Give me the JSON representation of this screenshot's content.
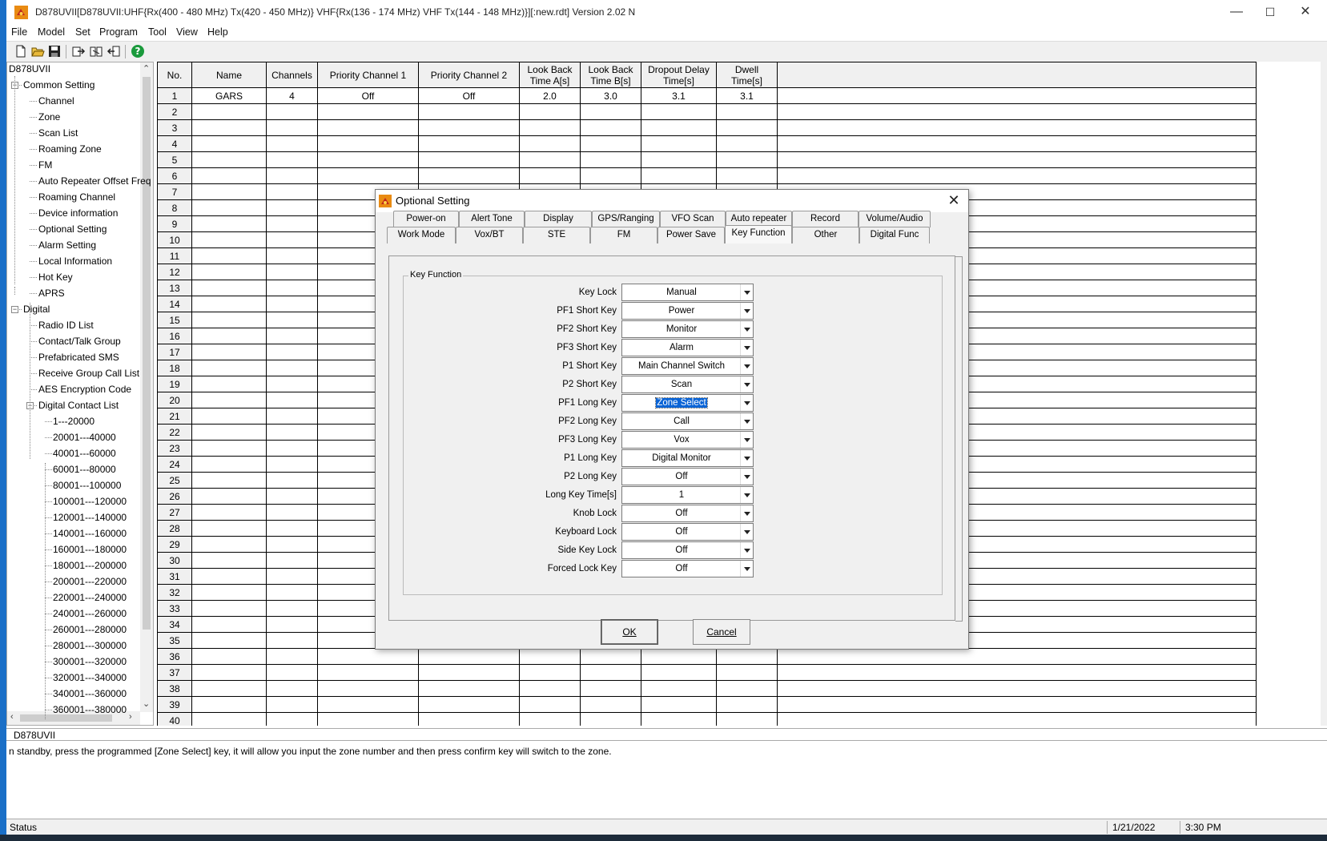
{
  "window": {
    "title": "D878UVII[D878UVII:UHF{Rx(400 - 480 MHz) Tx(420 - 450 MHz)} VHF{Rx(136 - 174 MHz) VHF Tx(144 - 148 MHz)}][:new.rdt] Version 2.02 N",
    "minimize": "—",
    "maximize": "☐",
    "close": "✕"
  },
  "menu": [
    "File",
    "Model",
    "Set",
    "Program",
    "Tool",
    "View",
    "Help"
  ],
  "toolbar": {
    "icons": [
      "new-file-icon",
      "open-folder-icon",
      "save-icon",
      "read-from-radio-icon",
      "write-to-radio-icon",
      "transfer-icon",
      "help-icon"
    ]
  },
  "tree": {
    "root": "D878UVII",
    "nodes": [
      {
        "label": "Common Setting",
        "level": 1,
        "expander": "−"
      },
      {
        "label": "Channel",
        "level": 2
      },
      {
        "label": "Zone",
        "level": 2
      },
      {
        "label": "Scan List",
        "level": 2
      },
      {
        "label": "Roaming Zone",
        "level": 2
      },
      {
        "label": "FM",
        "level": 2
      },
      {
        "label": "Auto Repeater Offset Freq",
        "level": 2
      },
      {
        "label": "Roaming Channel",
        "level": 2
      },
      {
        "label": "Device information",
        "level": 2
      },
      {
        "label": "Optional Setting",
        "level": 2
      },
      {
        "label": "Alarm Setting",
        "level": 2
      },
      {
        "label": "Local Information",
        "level": 2
      },
      {
        "label": "Hot Key",
        "level": 2
      },
      {
        "label": "APRS",
        "level": 2
      },
      {
        "label": "Digital",
        "level": 1,
        "expander": "−"
      },
      {
        "label": "Radio ID List",
        "level": 2
      },
      {
        "label": "Contact/Talk Group",
        "level": 2
      },
      {
        "label": "Prefabricated SMS",
        "level": 2
      },
      {
        "label": "Receive Group Call List",
        "level": 2
      },
      {
        "label": "AES Encryption Code",
        "level": 2
      },
      {
        "label": "Digital Contact List",
        "level": 2,
        "expander": "−"
      },
      {
        "label": "1---20000",
        "level": 3
      },
      {
        "label": "20001---40000",
        "level": 3
      },
      {
        "label": "40001---60000",
        "level": 3
      },
      {
        "label": "60001---80000",
        "level": 3
      },
      {
        "label": "80001---100000",
        "level": 3
      },
      {
        "label": "100001---120000",
        "level": 3
      },
      {
        "label": "120001---140000",
        "level": 3
      },
      {
        "label": "140001---160000",
        "level": 3
      },
      {
        "label": "160001---180000",
        "level": 3
      },
      {
        "label": "180001---200000",
        "level": 3
      },
      {
        "label": "200001---220000",
        "level": 3
      },
      {
        "label": "220001---240000",
        "level": 3
      },
      {
        "label": "240001---260000",
        "level": 3
      },
      {
        "label": "260001---280000",
        "level": 3
      },
      {
        "label": "280001---300000",
        "level": 3
      },
      {
        "label": "300001---320000",
        "level": 3
      },
      {
        "label": "320001---340000",
        "level": 3
      },
      {
        "label": "340001---360000",
        "level": 3
      },
      {
        "label": "360001---380000",
        "level": 3
      }
    ]
  },
  "grid": {
    "columns": [
      "No.",
      "Name",
      "Channels",
      "Priority Channel 1",
      "Priority Channel 2",
      "Look Back Time A[s]",
      "Look Back Time B[s]",
      "Dropout Delay Time[s]",
      "Dwell Time[s]",
      ""
    ],
    "row_count": 40,
    "rows": [
      [
        "1",
        "GARS",
        "4",
        "Off",
        "Off",
        "2.0",
        "3.0",
        "3.1",
        "3.1",
        ""
      ]
    ]
  },
  "dialog": {
    "title": "Optional Setting",
    "tabs_row1": [
      "Power-on",
      "Alert Tone",
      "Display",
      "GPS/Ranging",
      "VFO Scan",
      "Auto repeater",
      "Record",
      "Volume/Audio"
    ],
    "tabs_row2": [
      "Work Mode",
      "Vox/BT",
      "STE",
      "FM",
      "Power Save",
      "Key Function",
      "Other",
      "Digital Func"
    ],
    "active_tab": "Key Function",
    "group_title": "Key Function",
    "fields": [
      {
        "label": "Key Lock",
        "value": "Manual"
      },
      {
        "label": "PF1 Short Key",
        "value": "Power"
      },
      {
        "label": "PF2 Short Key",
        "value": "Monitor"
      },
      {
        "label": "PF3 Short Key",
        "value": "Alarm"
      },
      {
        "label": "P1 Short Key",
        "value": "Main Channel Switch"
      },
      {
        "label": "P2 Short Key",
        "value": "Scan"
      },
      {
        "label": "PF1 Long Key",
        "value": "Zone Select",
        "selected": true
      },
      {
        "label": "PF2 Long Key",
        "value": "Call"
      },
      {
        "label": "PF3 Long Key",
        "value": "Vox"
      },
      {
        "label": "P1 Long Key",
        "value": "Digital Monitor"
      },
      {
        "label": "P2 Long Key",
        "value": "Off"
      },
      {
        "label": "Long Key Time[s]",
        "value": "1"
      },
      {
        "label": "Knob Lock",
        "value": "Off"
      },
      {
        "label": "Keyboard Lock",
        "value": "Off"
      },
      {
        "label": "Side Key Lock",
        "value": "Off"
      },
      {
        "label": "Forced Lock Key",
        "value": "Off"
      }
    ],
    "ok_label": "OK",
    "cancel_label": "Cancel"
  },
  "bottom_pane": {
    "header": "D878UVII",
    "message": "n standby, press the programmed [Zone Select] key, it will allow you input the zone number and then press confirm key will switch to the zone."
  },
  "statusbar": {
    "status": "Status",
    "date": "1/21/2022",
    "time": "3:30 PM"
  },
  "colors": {
    "selection": "#0a64d6",
    "window_bg": "#f0f0f0",
    "accent_left": "#1a6fc7"
  }
}
